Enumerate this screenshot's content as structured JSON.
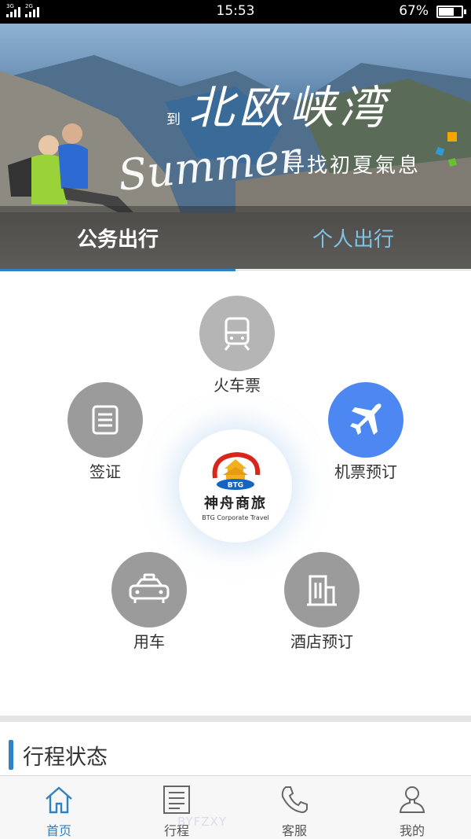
{
  "status_bar": {
    "network_1": "3G",
    "network_2": "2G",
    "time": "15:53",
    "battery_percent": "67%",
    "battery_level": 0.67
  },
  "banner": {
    "prefix": "到",
    "title": "北欧峡湾",
    "script_text": "Summer",
    "subtitle": "寻找初夏氣息",
    "tabs": [
      {
        "label": "公务出行",
        "active": true
      },
      {
        "label": "个人出行",
        "active": false
      }
    ]
  },
  "services": {
    "train": {
      "label": "火车票",
      "icon": "train-icon"
    },
    "visa": {
      "label": "签证",
      "icon": "document-icon"
    },
    "flight": {
      "label": "机票预订",
      "icon": "airplane-icon"
    },
    "car": {
      "label": "用车",
      "icon": "car-icon"
    },
    "hotel": {
      "label": "酒店预订",
      "icon": "building-icon"
    }
  },
  "logo": {
    "badge": "BTG",
    "name": "神舟商旅",
    "english": "BTG Corporate Travel"
  },
  "section": {
    "title": "行程状态"
  },
  "bottom_nav": [
    {
      "label": "首页",
      "icon": "home-icon",
      "active": true
    },
    {
      "label": "行程",
      "icon": "itinerary-icon",
      "active": false
    },
    {
      "label": "客服",
      "icon": "phone-icon",
      "active": false
    },
    {
      "label": "我的",
      "icon": "user-icon",
      "active": false
    }
  ],
  "watermark": "BYFZXY",
  "colors": {
    "accent": "#2f82c4",
    "flight_blue": "#4d87f2",
    "icon_grey": "#9b9b9b"
  }
}
